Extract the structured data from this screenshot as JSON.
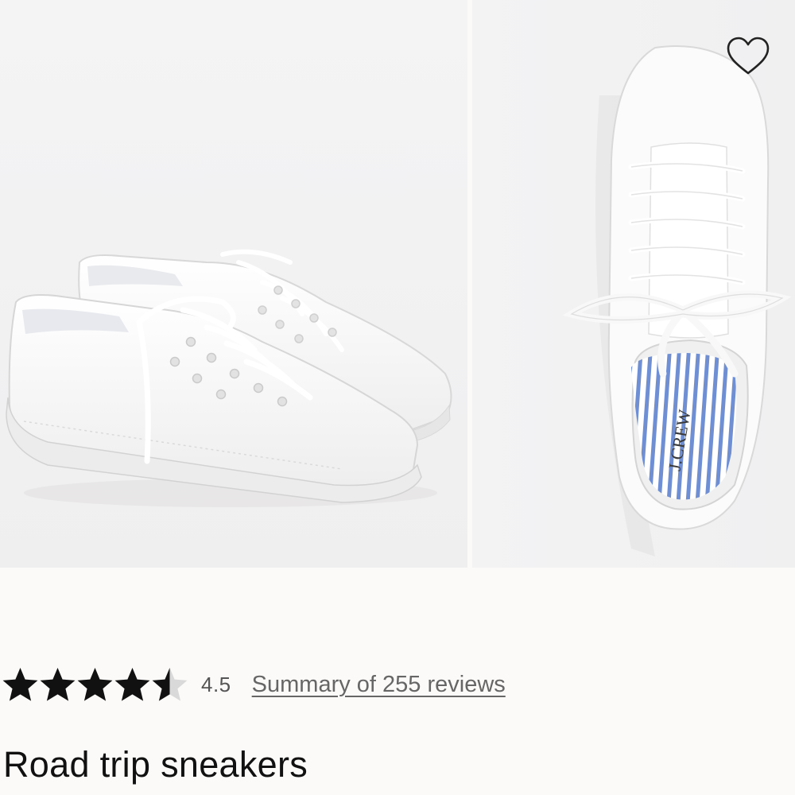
{
  "gallery": {
    "images": [
      {
        "alt": "Pair of white lace-up sneakers, side view"
      },
      {
        "alt": "White sneaker top view with blue striped insole"
      }
    ],
    "insole_brand": "J.CREW",
    "wishlist_icon": "heart-outline-icon"
  },
  "rating": {
    "value": 4.5,
    "value_label": "4.5",
    "max": 5,
    "star_icon": "star-icon",
    "star_color": "#111111",
    "reviews_link": "Summary of 255 reviews"
  },
  "product": {
    "title": "Road trip sneakers"
  }
}
